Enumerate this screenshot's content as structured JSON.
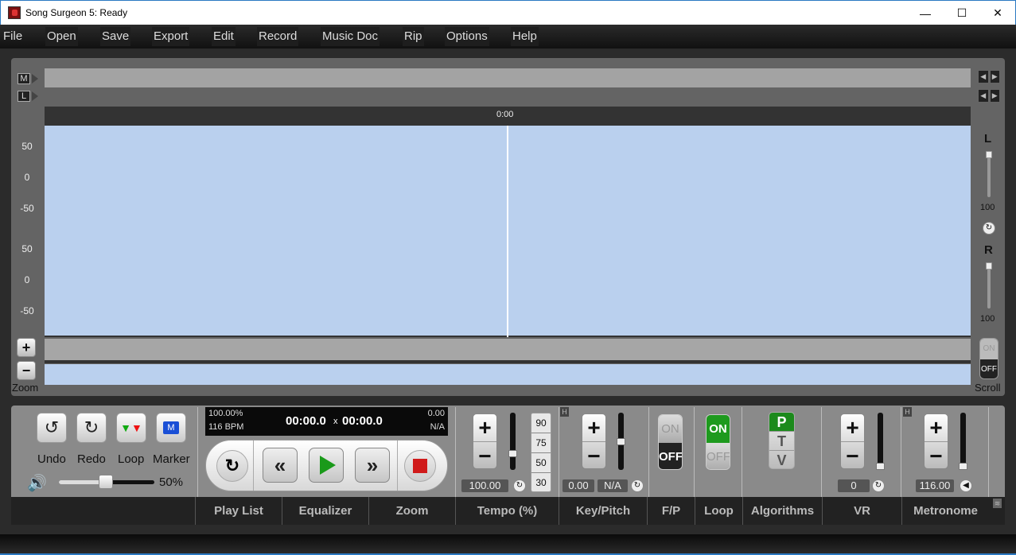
{
  "window": {
    "title": "Song Surgeon 5: Ready",
    "minimize": "—",
    "maximize": "☐",
    "close": "✕"
  },
  "menu": [
    "File",
    "Open",
    "Save",
    "Export",
    "Edit",
    "Record",
    "Music Doc",
    "Rip",
    "Options",
    "Help"
  ],
  "tracks": {
    "marker_label": "M",
    "loop_label": "L",
    "nav_left": "◀",
    "nav_right": "▶"
  },
  "timeline": {
    "time": "0:00"
  },
  "waveform": {
    "y_top": [
      "50",
      "0",
      "-50"
    ],
    "y_bottom": [
      "50",
      "0",
      "-50"
    ]
  },
  "zoom": {
    "plus": "+",
    "minus": "−",
    "label": "Zoom"
  },
  "balance": {
    "left_label": "L",
    "left_value": "100",
    "right_label": "R",
    "right_value": "100",
    "reset": "↻"
  },
  "scroll": {
    "on": "ON",
    "off": "OFF",
    "label": "Scroll",
    "state": "OFF"
  },
  "edit": {
    "undo": "Undo",
    "redo": "Redo",
    "loop": "Loop",
    "marker": "Marker",
    "marker_glyph": "M"
  },
  "volume": {
    "value": "50%",
    "level": 0.5
  },
  "lcd": {
    "tempo": "100.00%",
    "bpm": "116 BPM",
    "position": "00:00.0",
    "sep": "x",
    "length": "00:00.0",
    "key_value": "0.00",
    "key": "N/A"
  },
  "tempo": {
    "value": "100.00",
    "presets": [
      "90",
      "75",
      "50",
      "30"
    ],
    "level": 0.25
  },
  "key_pitch": {
    "value": "0.00",
    "key": "N/A",
    "level": 0.5
  },
  "fp": {
    "on": "ON",
    "off": "OFF",
    "state": "OFF"
  },
  "loop": {
    "on": "ON",
    "off": "OFF",
    "state": "ON"
  },
  "algorithms": {
    "options": [
      "P",
      "T",
      "V"
    ],
    "selected": "P"
  },
  "vr": {
    "value": "0",
    "level": 0.0
  },
  "metronome": {
    "value": "116.00",
    "level": 0.0
  },
  "tabs": [
    "Play List",
    "Equalizer",
    "Zoom",
    "Tempo (%)",
    "Key/Pitch",
    "F/P",
    "Loop",
    "Algorithms",
    "VR",
    "Metronome"
  ]
}
